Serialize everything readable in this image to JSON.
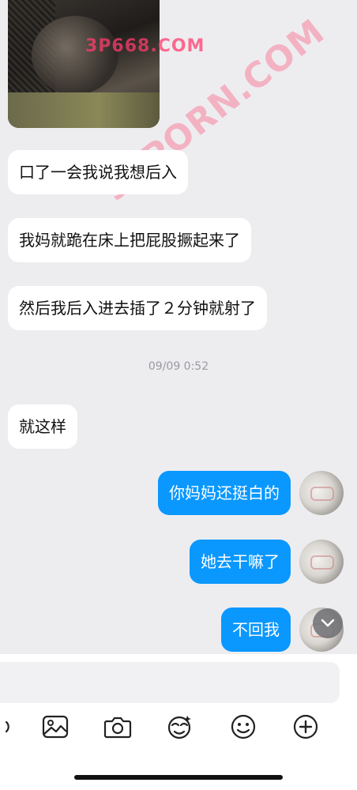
{
  "messages": [
    {
      "side": "in",
      "text": "口了一会我说我想后入"
    },
    {
      "side": "in",
      "text": "我妈就跪在床上把屁股撅起来了"
    },
    {
      "side": "in",
      "text": "然后我后入进去插了２分钟就射了"
    },
    {
      "side": "in",
      "text": "就这样"
    },
    {
      "side": "out",
      "text": "你妈妈还挺白的"
    },
    {
      "side": "out",
      "text": "她去干嘛了"
    },
    {
      "side": "out",
      "text": "不回我"
    }
  ],
  "timestamp": "09/09 0:52",
  "watermarks": [
    "3P668.COM",
    "91PORN.COM"
  ],
  "composer": {
    "placeholder": "",
    "value": ""
  },
  "toolbar": [
    "image-icon",
    "camera-icon",
    "sticker-icon",
    "emoji-icon",
    "plus-icon"
  ],
  "colors": {
    "outgoing": "#0a98ff",
    "incoming": "#ffffff",
    "background": "#ededf0"
  }
}
